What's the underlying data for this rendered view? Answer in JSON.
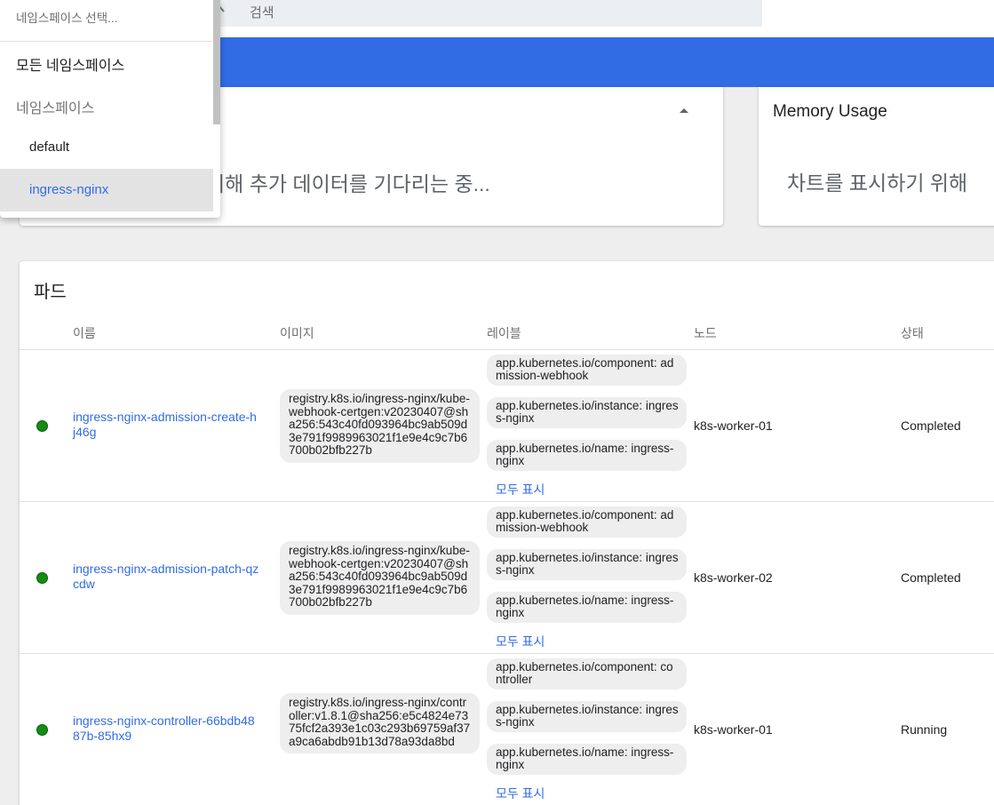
{
  "search": {
    "placeholder": "검색"
  },
  "cpu_card": {
    "waiting_text": "위해 추가 데이터를 기다리는 중..."
  },
  "memory_card": {
    "title": "Memory Usage",
    "waiting_text": "차트를 표시하기 위해"
  },
  "pods": {
    "title": "파드",
    "columns": {
      "name": "이름",
      "image": "이미지",
      "labels": "레이블",
      "node": "노드",
      "status": "상태"
    },
    "rows": [
      {
        "status_color": "#128d12",
        "name": "ingress-nginx-admission-create-hj46g",
        "image": "registry.k8s.io/ingress-nginx/kube-webhook-certgen:v20230407@sha256:543c40fd093964bc9ab509d3e791f9989963021f1e9e4c9c7b6700b02bfb227b",
        "labels": [
          "app.kubernetes.io/component: admission-webhook",
          "app.kubernetes.io/instance: ingress-nginx",
          "app.kubernetes.io/name: ingress-nginx"
        ],
        "show_all": "모두 표시",
        "node": "k8s-worker-01",
        "status": "Completed"
      },
      {
        "status_color": "#128d12",
        "name": "ingress-nginx-admission-patch-qzcdw",
        "image": "registry.k8s.io/ingress-nginx/kube-webhook-certgen:v20230407@sha256:543c40fd093964bc9ab509d3e791f9989963021f1e9e4c9c7b6700b02bfb227b",
        "labels": [
          "app.kubernetes.io/component: admission-webhook",
          "app.kubernetes.io/instance: ingress-nginx",
          "app.kubernetes.io/name: ingress-nginx"
        ],
        "show_all": "모두 표시",
        "node": "k8s-worker-02",
        "status": "Completed"
      },
      {
        "status_color": "#128d12",
        "name": "ingress-nginx-controller-66bdb4887b-85hx9",
        "image": "registry.k8s.io/ingress-nginx/controller:v1.8.1@sha256:e5c4824e7375fcf2a393e1c03c293b69759af37a9ca6abdb91b13d78a93da8bd",
        "labels": [
          "app.kubernetes.io/component: controller",
          "app.kubernetes.io/instance: ingress-nginx",
          "app.kubernetes.io/name: ingress-nginx"
        ],
        "show_all": "모두 표시",
        "node": "k8s-worker-01",
        "status": "Running"
      }
    ]
  },
  "namespace_dropdown": {
    "input_placeholder": "네임스페이스 선택...",
    "all_option": "모든 네임스페이스",
    "group_label": "네임스페이스",
    "options": [
      {
        "label": "default",
        "selected": false
      },
      {
        "label": "ingress-nginx",
        "selected": true
      }
    ]
  },
  "colors": {
    "accent": "#326ce5",
    "running": "#128d12"
  }
}
